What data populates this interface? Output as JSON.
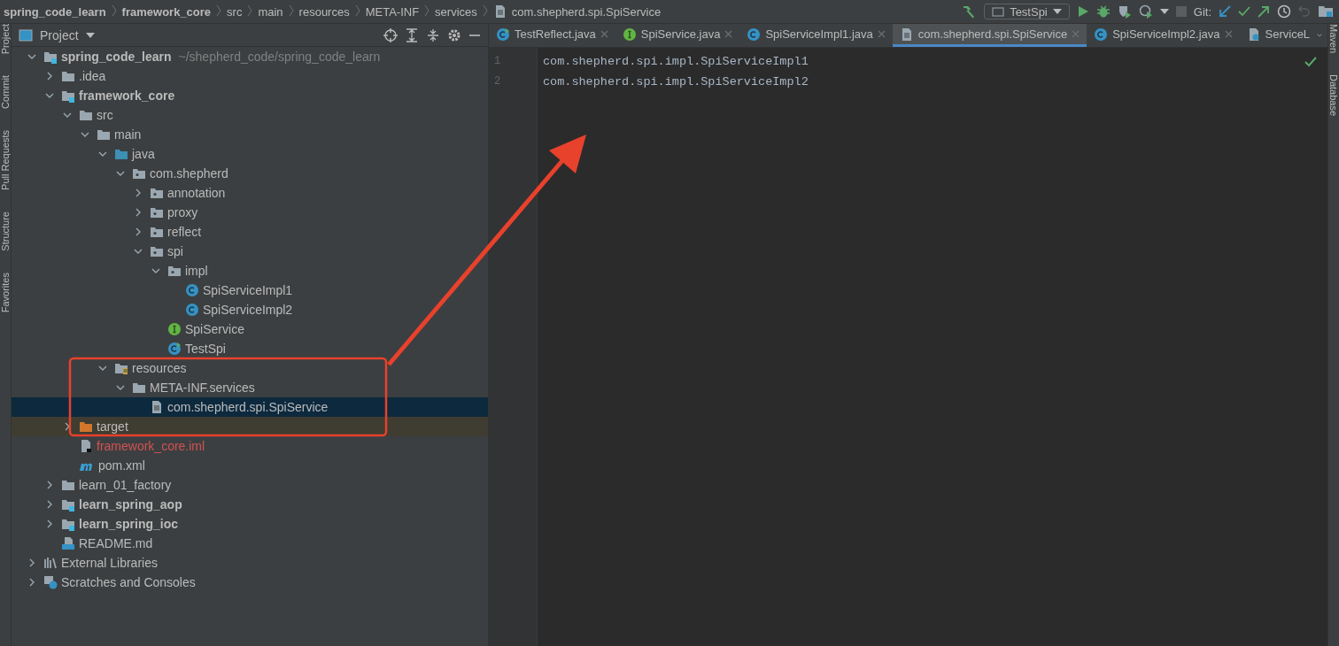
{
  "breadcrumbs": [
    {
      "label": "spring_code_learn",
      "kind": "module"
    },
    {
      "label": "framework_core",
      "kind": "module"
    },
    {
      "label": "src",
      "kind": "folder"
    },
    {
      "label": "main",
      "kind": "folder"
    },
    {
      "label": "resources",
      "kind": "folder"
    },
    {
      "label": "META-INF",
      "kind": "folder"
    },
    {
      "label": "services",
      "kind": "folder"
    },
    {
      "label": "com.shepherd.spi.SpiService",
      "kind": "file"
    }
  ],
  "toolbar": {
    "run_config": "TestSpi",
    "vcs_label": "Git:"
  },
  "left_strip": [
    "Project",
    "Commit",
    "Pull Requests",
    "Structure",
    "Favorites"
  ],
  "right_strip": [
    "Maven",
    "Database"
  ],
  "project_panel": {
    "title": "Project",
    "tree": [
      {
        "label": "spring_code_learn",
        "path": "~/shepherd_code/spring_code_learn",
        "kind": "module",
        "expanded": true,
        "selected": false,
        "children": [
          {
            "label": ".idea",
            "kind": "folder",
            "expanded": false,
            "selected": false
          },
          {
            "label": "framework_core",
            "kind": "module",
            "expanded": true,
            "selected": false,
            "children": [
              {
                "label": "src",
                "kind": "folder",
                "expanded": true,
                "selected": false,
                "children": [
                  {
                    "label": "main",
                    "kind": "folder",
                    "expanded": true,
                    "selected": false,
                    "children": [
                      {
                        "label": "java",
                        "kind": "source",
                        "expanded": true,
                        "selected": false,
                        "children": [
                          {
                            "label": "com.shepherd",
                            "kind": "package",
                            "expanded": true,
                            "selected": false,
                            "children": [
                              {
                                "label": "annotation",
                                "kind": "package",
                                "expanded": false,
                                "selected": false
                              },
                              {
                                "label": "proxy",
                                "kind": "package",
                                "expanded": false,
                                "selected": false
                              },
                              {
                                "label": "reflect",
                                "kind": "package",
                                "expanded": false,
                                "selected": false
                              },
                              {
                                "label": "spi",
                                "kind": "package",
                                "expanded": true,
                                "selected": false,
                                "children": [
                                  {
                                    "label": "impl",
                                    "kind": "package",
                                    "expanded": true,
                                    "selected": false,
                                    "children": [
                                      {
                                        "label": "SpiServiceImpl1",
                                        "kind": "class",
                                        "selected": false
                                      },
                                      {
                                        "label": "SpiServiceImpl2",
                                        "kind": "class",
                                        "selected": false
                                      }
                                    ]
                                  },
                                  {
                                    "label": "SpiService",
                                    "kind": "interface",
                                    "selected": false
                                  },
                                  {
                                    "label": "TestSpi",
                                    "kind": "main-class",
                                    "selected": false
                                  }
                                ]
                              }
                            ]
                          }
                        ]
                      },
                      {
                        "label": "resources",
                        "kind": "resources",
                        "expanded": true,
                        "selected": false,
                        "children": [
                          {
                            "label": "META-INF.services",
                            "kind": "folder",
                            "expanded": true,
                            "selected": false,
                            "children": [
                              {
                                "label": "com.shepherd.spi.SpiService",
                                "kind": "file",
                                "selected": true
                              }
                            ]
                          }
                        ]
                      }
                    ]
                  }
                ]
              },
              {
                "label": "target",
                "kind": "excluded",
                "expanded": false,
                "selected": false
              },
              {
                "label": "framework_core.iml",
                "kind": "iml",
                "selected": false
              },
              {
                "label": "pom.xml",
                "kind": "maven",
                "selected": false
              }
            ]
          },
          {
            "label": "learn_01_factory",
            "kind": "folder",
            "expanded": false,
            "selected": false
          },
          {
            "label": "learn_spring_aop",
            "kind": "module",
            "expanded": false,
            "selected": false
          },
          {
            "label": "learn_spring_ioc",
            "kind": "module",
            "expanded": false,
            "selected": false
          },
          {
            "label": "README.md",
            "kind": "markdown",
            "selected": false
          }
        ]
      },
      {
        "label": "External Libraries",
        "kind": "libraries",
        "expanded": false,
        "selected": false
      },
      {
        "label": "Scratches and Consoles",
        "kind": "scratches",
        "expanded": false,
        "selected": false
      }
    ]
  },
  "tabs": [
    {
      "label": "TestReflect.java",
      "kind": "main-class",
      "selected": false,
      "closable": true
    },
    {
      "label": "SpiService.java",
      "kind": "interface",
      "selected": false,
      "closable": true
    },
    {
      "label": "SpiServiceImpl1.java",
      "kind": "class",
      "selected": false,
      "closable": true
    },
    {
      "label": "com.shepherd.spi.SpiService",
      "kind": "file",
      "selected": true,
      "closable": true
    },
    {
      "label": "SpiServiceImpl2.java",
      "kind": "class",
      "selected": false,
      "closable": true
    },
    {
      "label": "ServiceL",
      "kind": "service",
      "selected": false,
      "closable": false
    }
  ],
  "editor": {
    "lines": [
      {
        "number": "1",
        "code": "com.shepherd.spi.impl.SpiServiceImpl1"
      },
      {
        "number": "2",
        "code": "com.shepherd.spi.impl.SpiServiceImpl2"
      }
    ]
  }
}
